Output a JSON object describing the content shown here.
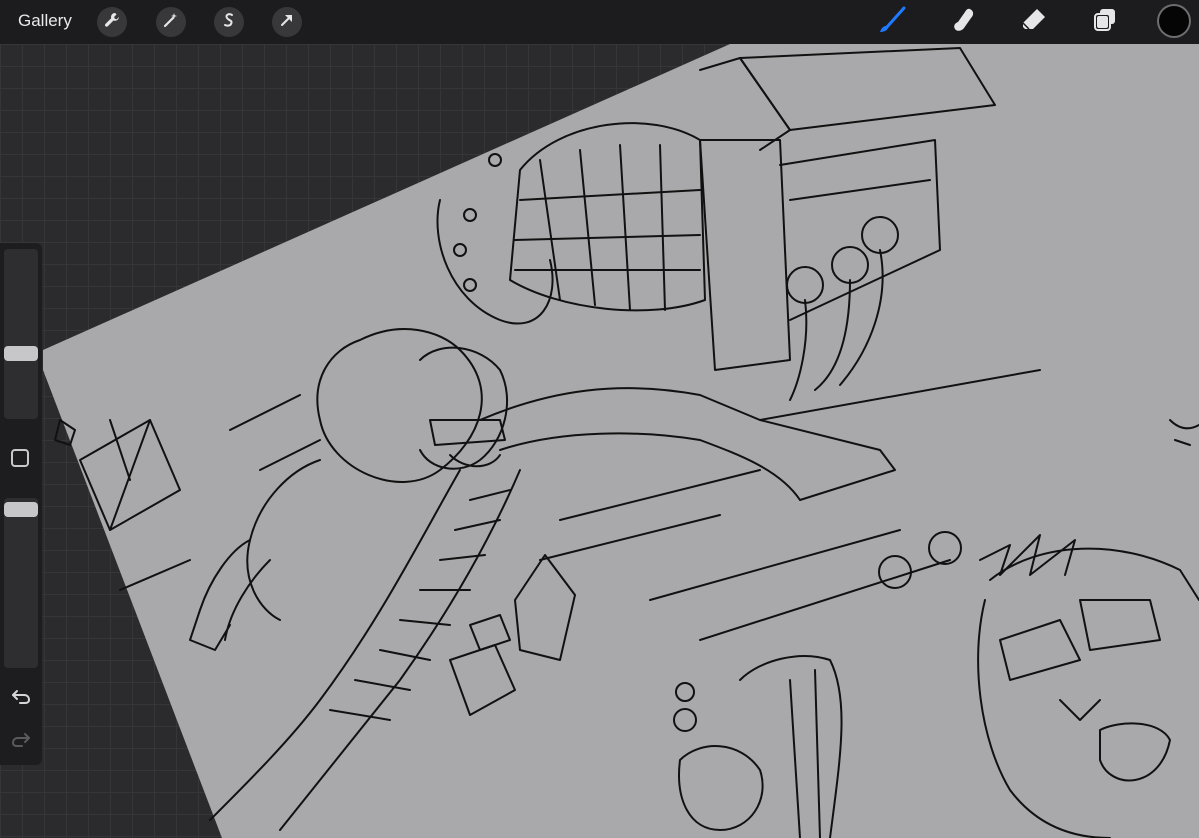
{
  "app": {
    "gallery_label": "Gallery"
  },
  "toolbar_left": [
    {
      "name": "actions",
      "icon": "wrench-icon"
    },
    {
      "name": "adjustments",
      "icon": "magic-wand-icon"
    },
    {
      "name": "selection",
      "icon": "selection-s-icon"
    },
    {
      "name": "transform",
      "icon": "arrow-cursor-icon"
    }
  ],
  "toolbar_right": [
    {
      "name": "brush",
      "icon": "brush-icon",
      "active": true
    },
    {
      "name": "smudge",
      "icon": "smudge-finger-icon",
      "active": false
    },
    {
      "name": "eraser",
      "icon": "eraser-icon",
      "active": false
    },
    {
      "name": "layers",
      "icon": "layers-icon",
      "active": false
    }
  ],
  "colors": {
    "accent": "#1e7bff",
    "current_color": "#050505",
    "canvas_paper": "#a9a9ab",
    "ink": "#111111"
  },
  "sidebar": {
    "brush_size_level": 0.22,
    "opacity_level": 0.1,
    "undo_icon": "undo-arrow-icon",
    "redo_icon": "redo-arrow-icon",
    "modify_icon": "square-modify-icon"
  }
}
